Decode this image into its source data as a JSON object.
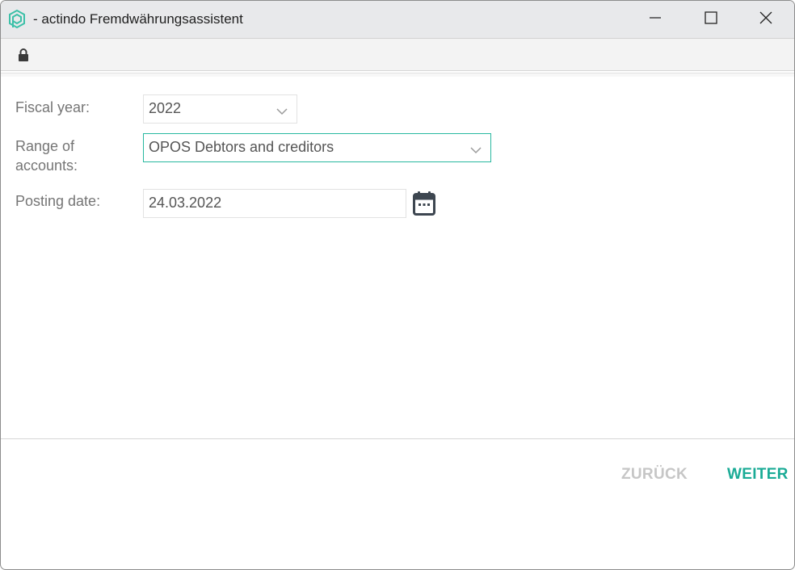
{
  "window": {
    "title": "- actindo Fremdwährungsassistent",
    "icon": "actindo-logo-icon",
    "controls": [
      "minimize-icon",
      "maximize-icon",
      "close-icon"
    ]
  },
  "addressbar": {
    "icon": "lock-icon"
  },
  "form": {
    "fiscal_year": {
      "label": "Fiscal year:",
      "value": "2022"
    },
    "range_of_accounts": {
      "label_line1": "Range of",
      "label_line2": "accounts:",
      "value": "OPOS Debtors and creditors"
    },
    "posting_date": {
      "label": "Posting date:",
      "value": "24.03.2022",
      "icon": "calendar-icon"
    }
  },
  "footer": {
    "back_label": "ZURÜCK",
    "next_label": "WEITER"
  },
  "colors": {
    "accent": "#1aab96",
    "focus_border": "#28b8a0",
    "disabled": "#c6c6c6"
  }
}
